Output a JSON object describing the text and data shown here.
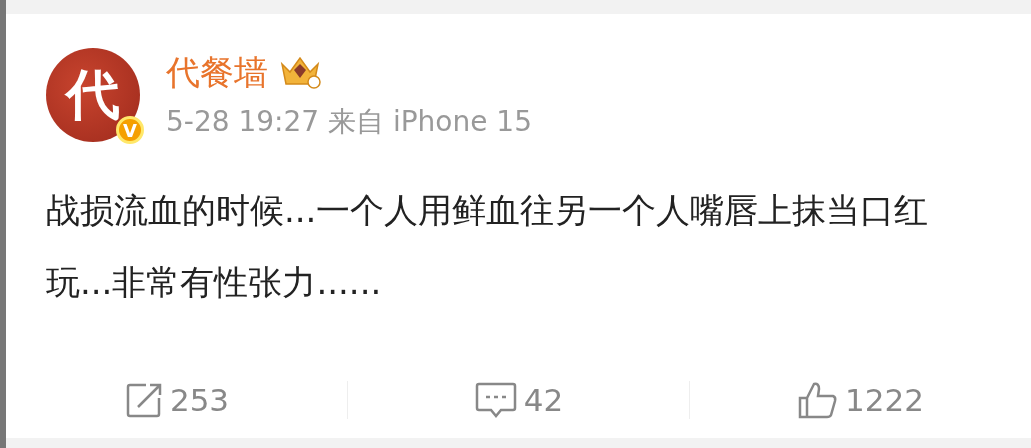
{
  "post": {
    "avatar": {
      "letter": "代",
      "verified": true,
      "badge_letter": "V"
    },
    "author": "代餐墙",
    "member_badge": true,
    "meta": "5-28 19:27 来自 iPhone 15",
    "text": "战损流血的时候...一个人用鲜血往另一个人嘴唇上抹当口红玩...非常有性张力......"
  },
  "actions": [
    {
      "kind": "repost",
      "count": "253"
    },
    {
      "kind": "comment",
      "count": "42"
    },
    {
      "kind": "like",
      "count": "1222"
    }
  ]
}
